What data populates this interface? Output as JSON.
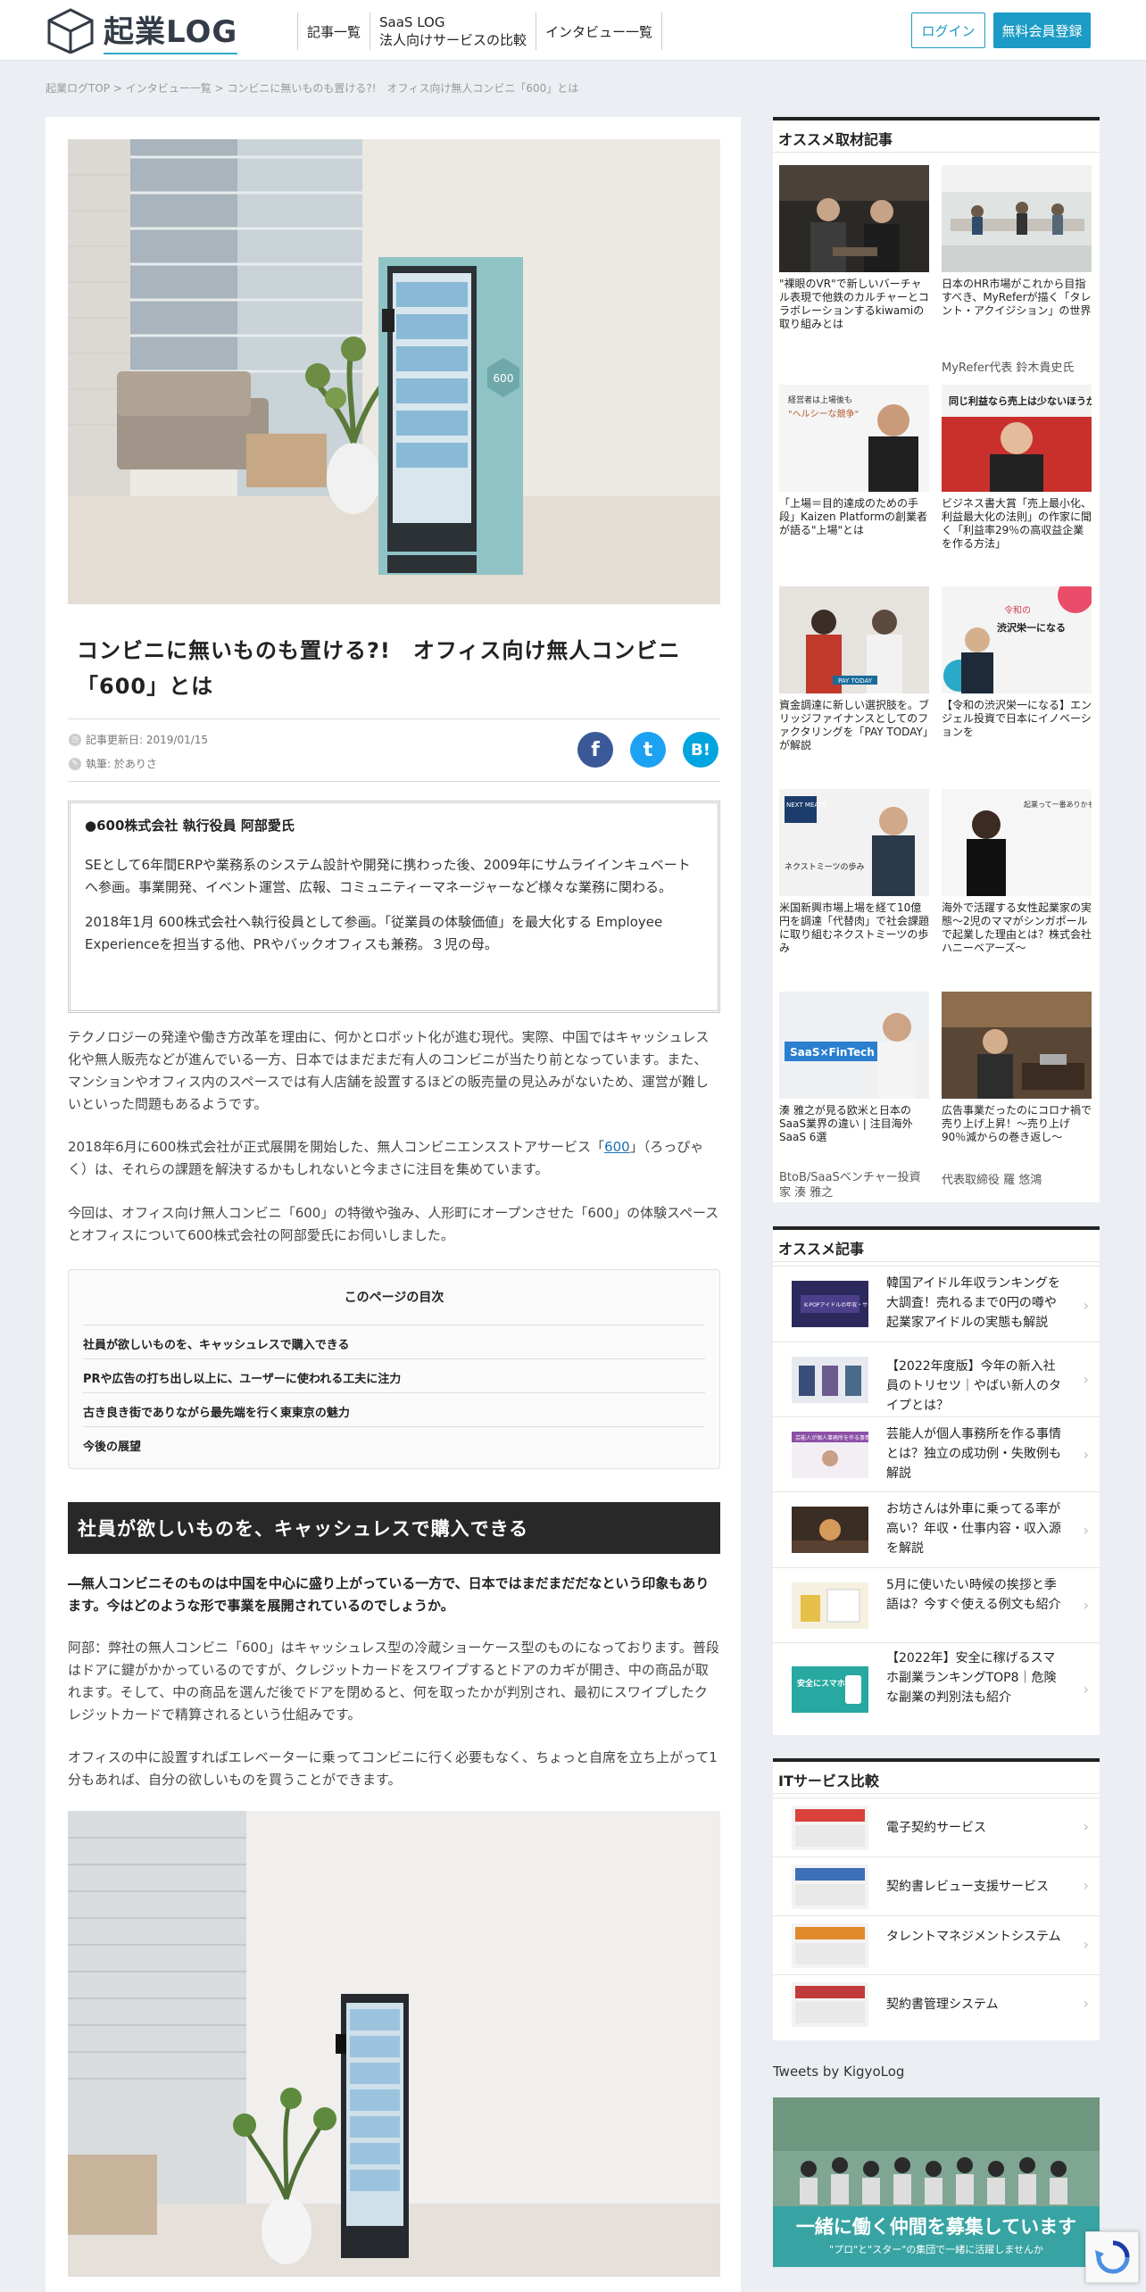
{
  "header": {
    "logo_text": "起業LOG",
    "nav": [
      {
        "label": "記事一覧"
      },
      {
        "label": "SaaS LOG",
        "sub": "法人向けサービスの比較"
      },
      {
        "label": "インタビュー一覧"
      }
    ],
    "login": "ログイン",
    "register": "無料会員登録"
  },
  "breadcrumb": "起業ログTOP > インタビュー一覧 > コンビニに無いものも置ける?!　オフィス向け無人コンビニ「600」とは",
  "article": {
    "title": "コンビニに無いものも置ける?!　オフィス向け無人コンビニ「600」とは",
    "updated": "記事更新日: 2019/01/15",
    "author": "執筆: 於ありさ",
    "share": {
      "fb": "f",
      "tw": "t",
      "hb": "B!"
    },
    "profile": {
      "name": "●600株式会社 執行役員 阿部愛氏",
      "p1": "SEとして6年間ERPや業務系のシステム設計や開発に携わった後、2009年にサムライインキュベートへ参画。事業開発、イベント運営、広報、コミュニティーマネージャーなど様々な業務に関わる。",
      "p2": "2018年1月 600株式会社へ執行役員として参画。「従業員の体験価値」を最大化する Employee Experienceを担当する他、PRやバックオフィスも兼務。３児の母。"
    },
    "intro1": "テクノロジーの発達や働き方改革を理由に、何かとロボット化が進む現代。実際、中国ではキャッシュレス化や無人販売などが進んでいる一方、日本ではまだまだ有人のコンビニが当たり前となっています。また、マンションやオフィス内のスペースでは有人店舗を設置するほどの販売量の見込みがないため、運営が難しいといった問題もあるようです。",
    "intro2_a": "2018年6月に600株式会社が正式展開を開始した、無人コンビニエンスストアサービス「",
    "intro2_link": "600",
    "intro2_b": "」（ろっぴゃく）は、それらの課題を解決するかもしれないと今まさに注目を集めています。",
    "intro3": "今回は、オフィス向け無人コンビニ「600」の特徴や強み、人形町にオープンさせた「600」の体験スペースとオフィスについて600株式会社の阿部愛氏にお伺いしました。",
    "toc": {
      "title": "このページの目次",
      "items": [
        "社員が欲しいものを、キャッシュレスで購入できる",
        "PRや広告の打ち出し以上に、ユーザーに使われる工夫に注力",
        "古き良き街でありながら最先端を行く東東京の魅力",
        "今後の展望"
      ]
    },
    "section1": "社員が欲しいものを、キャッシュレスで購入できる",
    "lead": "―無人コンビニそのものは中国を中心に盛り上がっている一方で、日本ではまだまだだなという印象もあります。今はどのような形で事業を展開されているのでしょうか。",
    "body1": "阿部：弊社の無人コンビニ「600」はキャッシュレス型の冷蔵ショーケース型のものになっております。普段はドアに鍵がかかっているのですが、クレジットカードをスワイプするとドアのカギが開き、中の商品が取れます。そして、中の商品を選んだ後でドアを閉めると、何を取ったかが判別され、最初にスワイプしたクレジットカードで精算されるという仕組みです。",
    "body2": "オフィスの中に設置すればエレベーターに乗ってコンビニに行く必要もなく、ちょっと自席を立ち上がって1分もあれば、自分の欲しいものを買うことができます。",
    "hero_badge": "600"
  },
  "sidebar": {
    "picks_title": "オススメ取材記事",
    "picks": [
      {
        "caption": "\"裸眼のVR\"で新しいバーチャル表現で他鉄のカルチャーとコラボレーションするkiwamiの取り組みとは",
        "author": ""
      },
      {
        "caption": "日本のHR市場がこれから目指すべき、MyReferが描く「タレント・アクイジション」の世界",
        "author": "MyRefer代表 鈴木貴史氏"
      },
      {
        "caption": "「上場＝目的達成のための手段」Kaizen Platformの創業者が語る\"上場\"とは",
        "author": ""
      },
      {
        "caption": "ビジネス書大賞「売上最小化、利益最大化の法則」の作家に聞く「利益率29％の高収益企業を作る方法」",
        "author": ""
      },
      {
        "caption": "資金調達に新しい選択肢を。ブリッジファイナンスとしてのファクタリングを「PAY TODAY」が解説",
        "author": ""
      },
      {
        "caption": "【令和の渋沢栄一になる】エンジェル投資で日本にイノベーションを",
        "author": ""
      },
      {
        "caption": "米国新興市場上場を経て10億円を調達「代替肉」で社会課題に取り組むネクストミーツの歩み",
        "author": ""
      },
      {
        "caption": "海外で活躍する女性起業家の実態〜2児のママがシンガポールで起業した理由とは？株式会社ハニーベアーズ〜",
        "author": ""
      },
      {
        "caption": "湊 雅之が見る欧米と日本のSaaS業界の違い | 注目海外SaaS 6選",
        "author": "BtoB/SaaSベンチャー投資家 湊 雅之"
      },
      {
        "caption": "広告事業だったのにコロナ禍で売り上げ上昇！〜売り上げ90％減からの巻き返し〜",
        "author": "代表取締役 羅 悠鴻"
      }
    ],
    "pick_thumb_texts": {
      "p3a": "経営者は上場後も",
      "p3b": "\"ヘルシーな競争\"",
      "p4": "同じ利益なら売上は少ないほうがいい",
      "p5": "PAY TODAY",
      "p6a": "令和の",
      "p6b": "渋沢栄一になる",
      "p7a": "NEXT MEATS",
      "p7b": "ネクストミーツの歩み",
      "p8": "起業って一番ありかも",
      "p9": "SaaS×FinTech"
    },
    "rec_title": "オススメ記事",
    "rec": [
      "韓国アイドル年収ランキングを大調査！売れるまで0円の噂や起業家アイドルの実態も解説",
      "【2022年度版】今年の新入社員のトリセツ｜やばい新人のタイプとは？",
      "芸能人が個人事務所を作る事情とは？独立の成功例・失敗例も解説",
      "お坊さんは外車に乗ってる率が高い？年収・仕事内容・収入源を解説",
      "5月に使いたい時候の挨拶と季語は？今すぐ使える例文も紹介",
      "【2022年】安全に稼げるスマホ副業ランキングTOP8｜危険な副業の判別法も紹介"
    ],
    "rec_thumb_texts": {
      "r1": "K-POPアイドルの年収・サイドビジネス事情",
      "r3": "芸能人が個人事務所を作る事情",
      "r6": "安全にスマホ副業"
    },
    "it_title": "ITサービス比較",
    "it": [
      "電子契約サービス",
      "契約書レビュー支援サービス",
      "タレントマネジメントシステム",
      "契約書管理システム"
    ],
    "tweets_label": "Tweets by KigyoLog",
    "tweet_banner_1": "一緒に働く仲間を募集しています",
    "tweet_banner_2": "\"プロ\"と\"スター\"の集団で一緒に活躍しませんか"
  },
  "colors": {
    "accent": "#1b9bc6",
    "dark": "#282828",
    "fb": "#3b5998",
    "tw": "#1da1f2",
    "hb": "#00a4de"
  }
}
